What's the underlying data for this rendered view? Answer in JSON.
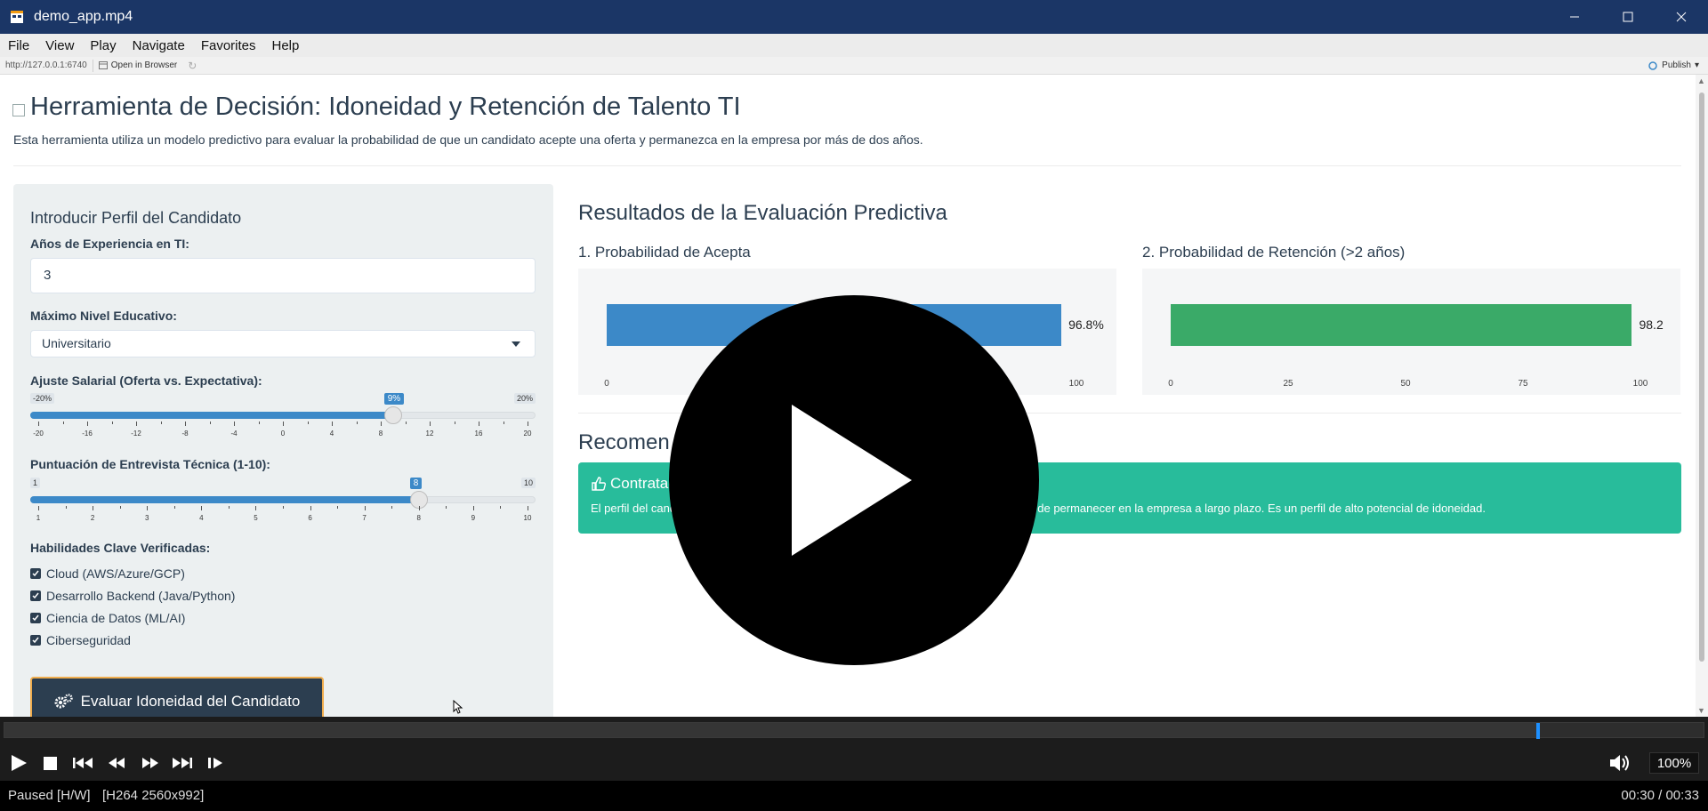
{
  "window": {
    "title": "demo_app.mp4"
  },
  "menu": [
    "File",
    "View",
    "Play",
    "Navigate",
    "Favorites",
    "Help"
  ],
  "address": {
    "url": "http://127.0.0.1:6740",
    "open_browser": "Open in Browser",
    "publish": "Publish"
  },
  "app": {
    "title": "Herramienta de Decisión: Idoneidad y Retención de Talento TI",
    "subtitle": "Esta herramienta utiliza un modelo predictivo para evaluar la probabilidad de que un candidato acepte una oferta y permanezca en la empresa por más de dos años."
  },
  "sidebar": {
    "title": "Introducir Perfil del Candidato",
    "exp_label": "Años de Experiencia en TI:",
    "exp_value": "3",
    "edu_label": "Máximo Nivel Educativo:",
    "edu_value": "Universitario",
    "salary": {
      "label": "Ajuste Salarial (Oferta vs. Expectativa):",
      "min_label": "-20%",
      "max_label": "20%",
      "value_label": "9%",
      "min": -20,
      "max": 20,
      "value": 9,
      "ticks": [
        "-20",
        "-16",
        "-12",
        "-8",
        "-4",
        "0",
        "4",
        "8",
        "12",
        "16",
        "20"
      ]
    },
    "interview": {
      "label": "Puntuación de Entrevista Técnica (1-10):",
      "min_label": "1",
      "max_label": "10",
      "value_label": "8",
      "min": 1,
      "max": 10,
      "value": 8,
      "ticks": [
        "1",
        "2",
        "3",
        "4",
        "5",
        "6",
        "7",
        "8",
        "9",
        "10"
      ]
    },
    "skills_label": "Habilidades Clave Verificadas:",
    "skills": [
      "Cloud (AWS/Azure/GCP)",
      "Desarrollo Backend (Java/Python)",
      "Ciencia de Datos (ML/AI)",
      "Ciberseguridad"
    ],
    "button": "Evaluar Idoneidad del Candidato"
  },
  "results": {
    "title": "Resultados de la Evaluación Predictiva",
    "chart1_title": "1. Probabilidad de Acepta",
    "chart2_title": "2. Probabilidad de Retención (>2 años)",
    "recom_title": "Recomen",
    "recom_heading": "Contratacio",
    "recom_text_left": "El perfil del candidato",
    "recom_text_right": "a como de permanecer en la empresa a largo plazo. Es un perfil de alto potencial de idoneidad."
  },
  "chart_data": [
    {
      "type": "bar",
      "title": "",
      "categories": [
        ""
      ],
      "values": [
        96.8
      ],
      "value_label": "96.8%",
      "xlim": [
        0,
        100
      ],
      "xticks": [
        "0",
        "100"
      ],
      "color": "#3c89c8"
    },
    {
      "type": "bar",
      "title": "",
      "categories": [
        ""
      ],
      "values": [
        98.2
      ],
      "value_label": "98.2",
      "xlim": [
        0,
        100
      ],
      "xticks": [
        "0",
        "25",
        "50",
        "75",
        "100"
      ],
      "color": "#3aaa68"
    }
  ],
  "player": {
    "status": "Paused [H/W]",
    "codec": "[H264 2560x992]",
    "time": "00:30 / 00:33",
    "zoom": "100%",
    "progress": 0.902
  },
  "colors": {
    "titlebar": "#1b3666",
    "accent": "#3c89c8",
    "success": "#28bc9b",
    "dark": "#2c3e50"
  }
}
